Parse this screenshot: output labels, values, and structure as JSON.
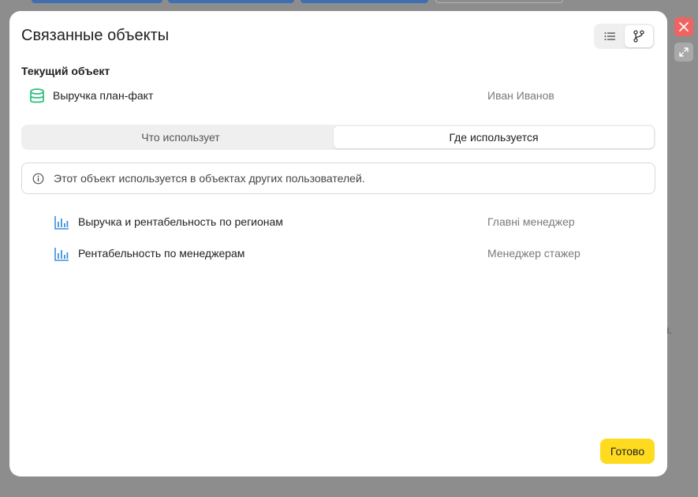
{
  "dialog": {
    "title": "Связанные объекты",
    "done_label": "Готово"
  },
  "current": {
    "section_label": "Текущий объект",
    "name": "Выручка план-факт",
    "owner": "Иван Иванов",
    "icon": "database-icon"
  },
  "tabs": [
    {
      "label": "Что использует",
      "selected": false
    },
    {
      "label": "Где используется",
      "selected": true
    }
  ],
  "notice": {
    "text": "Этот объект используется в объектах других пользователей.",
    "icon": "info-icon"
  },
  "dependents": [
    {
      "name": "Выручка и рентабельность по регионам",
      "owner": "Главні менеджер",
      "icon": "bar-chart-icon"
    },
    {
      "name": "Рентабельность по менеджерам",
      "owner": "Менеджер стажер",
      "icon": "bar-chart-icon"
    }
  ],
  "background": {
    "partial_text": "ия."
  },
  "colors": {
    "accent_yellow": "#ffdb1f",
    "database_green": "#2ec27e",
    "chart_blue": "#3d8fe0",
    "close_red": "#ef6461"
  }
}
